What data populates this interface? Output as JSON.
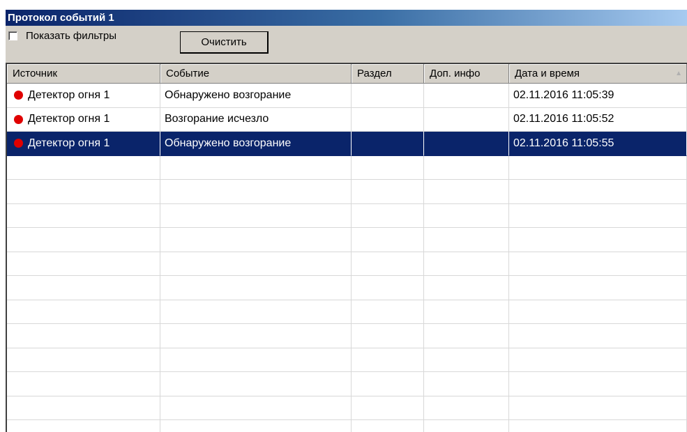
{
  "window": {
    "title": "Протокол событий 1"
  },
  "toolbar": {
    "show_filters_label": "Показать фильтры",
    "show_filters_checked": false,
    "clear_label": "Очистить"
  },
  "table": {
    "columns": [
      "Источник",
      "Событие",
      "Раздел",
      "Доп. инфо",
      "Дата и время"
    ],
    "sort_indicator": "▲",
    "rows": [
      {
        "source": "Детектор огня 1",
        "event": "Обнаружено возгорание",
        "section": "",
        "info": "",
        "datetime": "02.11.2016 11:05:39",
        "icon": "red-dot-icon",
        "selected": false
      },
      {
        "source": "Детектор огня 1",
        "event": "Возгорание исчезло",
        "section": "",
        "info": "",
        "datetime": "02.11.2016 11:05:52",
        "icon": "red-dot-icon",
        "selected": false
      },
      {
        "source": "Детектор огня 1",
        "event": "Обнаружено возгорание",
        "section": "",
        "info": "",
        "datetime": "02.11.2016 11:05:55",
        "icon": "red-dot-icon",
        "selected": true
      }
    ]
  },
  "colors": {
    "selection": "#0a246a",
    "status_dot": "#e00000"
  }
}
